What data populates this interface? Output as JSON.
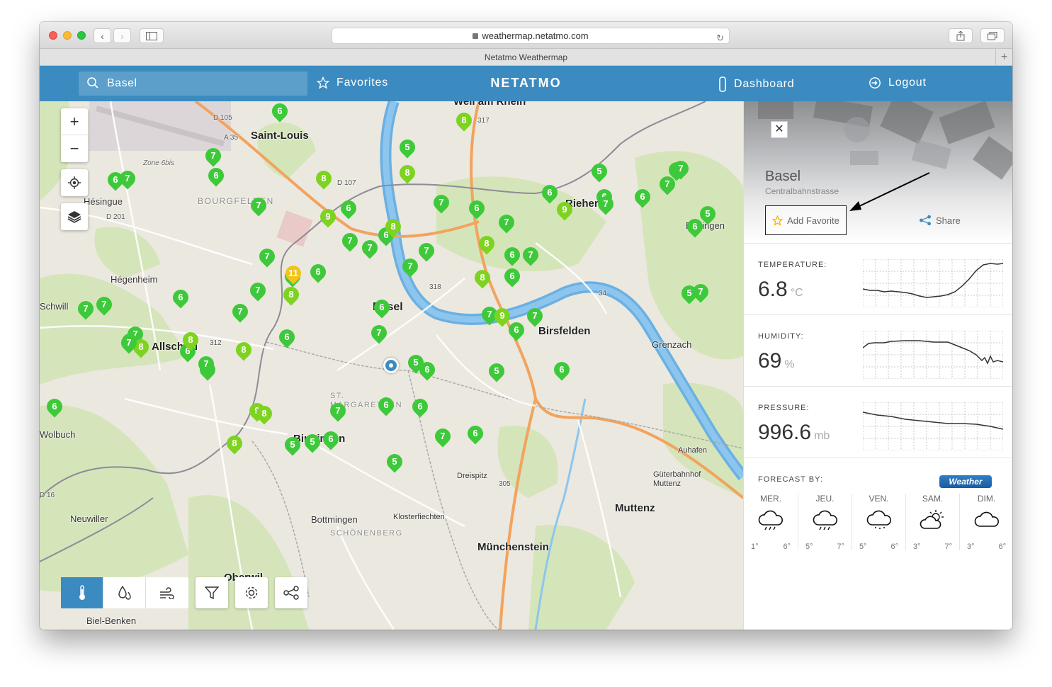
{
  "browser": {
    "url": "weathermap.netatmo.com",
    "tab_title": "Netatmo Weathermap"
  },
  "header": {
    "search_value": "Basel",
    "favorites_label": "Favorites",
    "brand": "NETATMO",
    "dashboard_label": "Dashboard",
    "logout_label": "Logout",
    "color": "#3b8bc1"
  },
  "map": {
    "labels": [
      "Saint-Louis",
      "Hésingue",
      "BOURGFELDEN",
      "Hégenheim",
      "Allschwil",
      "Basel",
      "Birsfelden",
      "Grenzach",
      "ST. MARGARETHEN",
      "Binningen",
      "Bottmingen",
      "SCHÖNENBERG",
      "Münchenstein",
      "Muttenz",
      "Neuwiller",
      "Dreispitz",
      "Klosterfiechten",
      "Auhafen",
      "Güterbahnhof Muttenz",
      "Riehen",
      "Bettingen",
      "Weil am Rhein",
      "Biel-Benken",
      "Oberwil",
      "Zone 6bis",
      "D 105",
      "A 35",
      "D 107",
      "D 201",
      "D 16",
      "312",
      "318",
      "305",
      "317",
      "34",
      "Schwill",
      "Wolbuch",
      "Bettingen"
    ],
    "marker_values": [
      7,
      6,
      7,
      7,
      6,
      7,
      8,
      5,
      8,
      6,
      9,
      6,
      8,
      7,
      7,
      7,
      6,
      11,
      7,
      7,
      7,
      6,
      7,
      6,
      8,
      6,
      7,
      6,
      8,
      5,
      6,
      9,
      7,
      6,
      7,
      7,
      7,
      5,
      6,
      7,
      5,
      7,
      9,
      7,
      6,
      6,
      7,
      6,
      6,
      8,
      5,
      7,
      7,
      6,
      8,
      7,
      7,
      7,
      6,
      8,
      7,
      6,
      8,
      7,
      8,
      6,
      7,
      6,
      9,
      8,
      8,
      5,
      5,
      7,
      6,
      6,
      7,
      6,
      6,
      6,
      5,
      5,
      6
    ],
    "zoom_in": "+",
    "zoom_out": "−"
  },
  "toolbar": {
    "modes": [
      "thermometer-icon",
      "humidity-icon",
      "wind-icon"
    ],
    "filter": "filter-icon",
    "settings": "gear-icon",
    "share": "share-icon"
  },
  "panel": {
    "title": "Basel",
    "subtitle": "Centralbahnstrasse",
    "add_favorite": "Add Favorite",
    "share": "Share",
    "temperature": {
      "label": "TEMPERATURE:",
      "value": "6.8",
      "unit": "°C"
    },
    "humidity": {
      "label": "HUMIDITY:",
      "value": "69",
      "unit": "%"
    },
    "pressure": {
      "label": "PRESSURE:",
      "value": "996.6",
      "unit": "mb"
    },
    "forecast": {
      "label": "FORECAST BY:",
      "provider": "Weather",
      "days": [
        {
          "name": "MER.",
          "min": "1°",
          "max": "6°",
          "icon": "cloud-rain-icon"
        },
        {
          "name": "JEU.",
          "min": "5°",
          "max": "7°",
          "icon": "cloud-rain-icon"
        },
        {
          "name": "VEN.",
          "min": "5°",
          "max": "6°",
          "icon": "cloud-drizzle-icon"
        },
        {
          "name": "SAM.",
          "min": "3°",
          "max": "7°",
          "icon": "sun-cloud-icon"
        },
        {
          "name": "DIM.",
          "min": "3°",
          "max": "6°",
          "icon": "cloud-icon"
        }
      ]
    }
  }
}
